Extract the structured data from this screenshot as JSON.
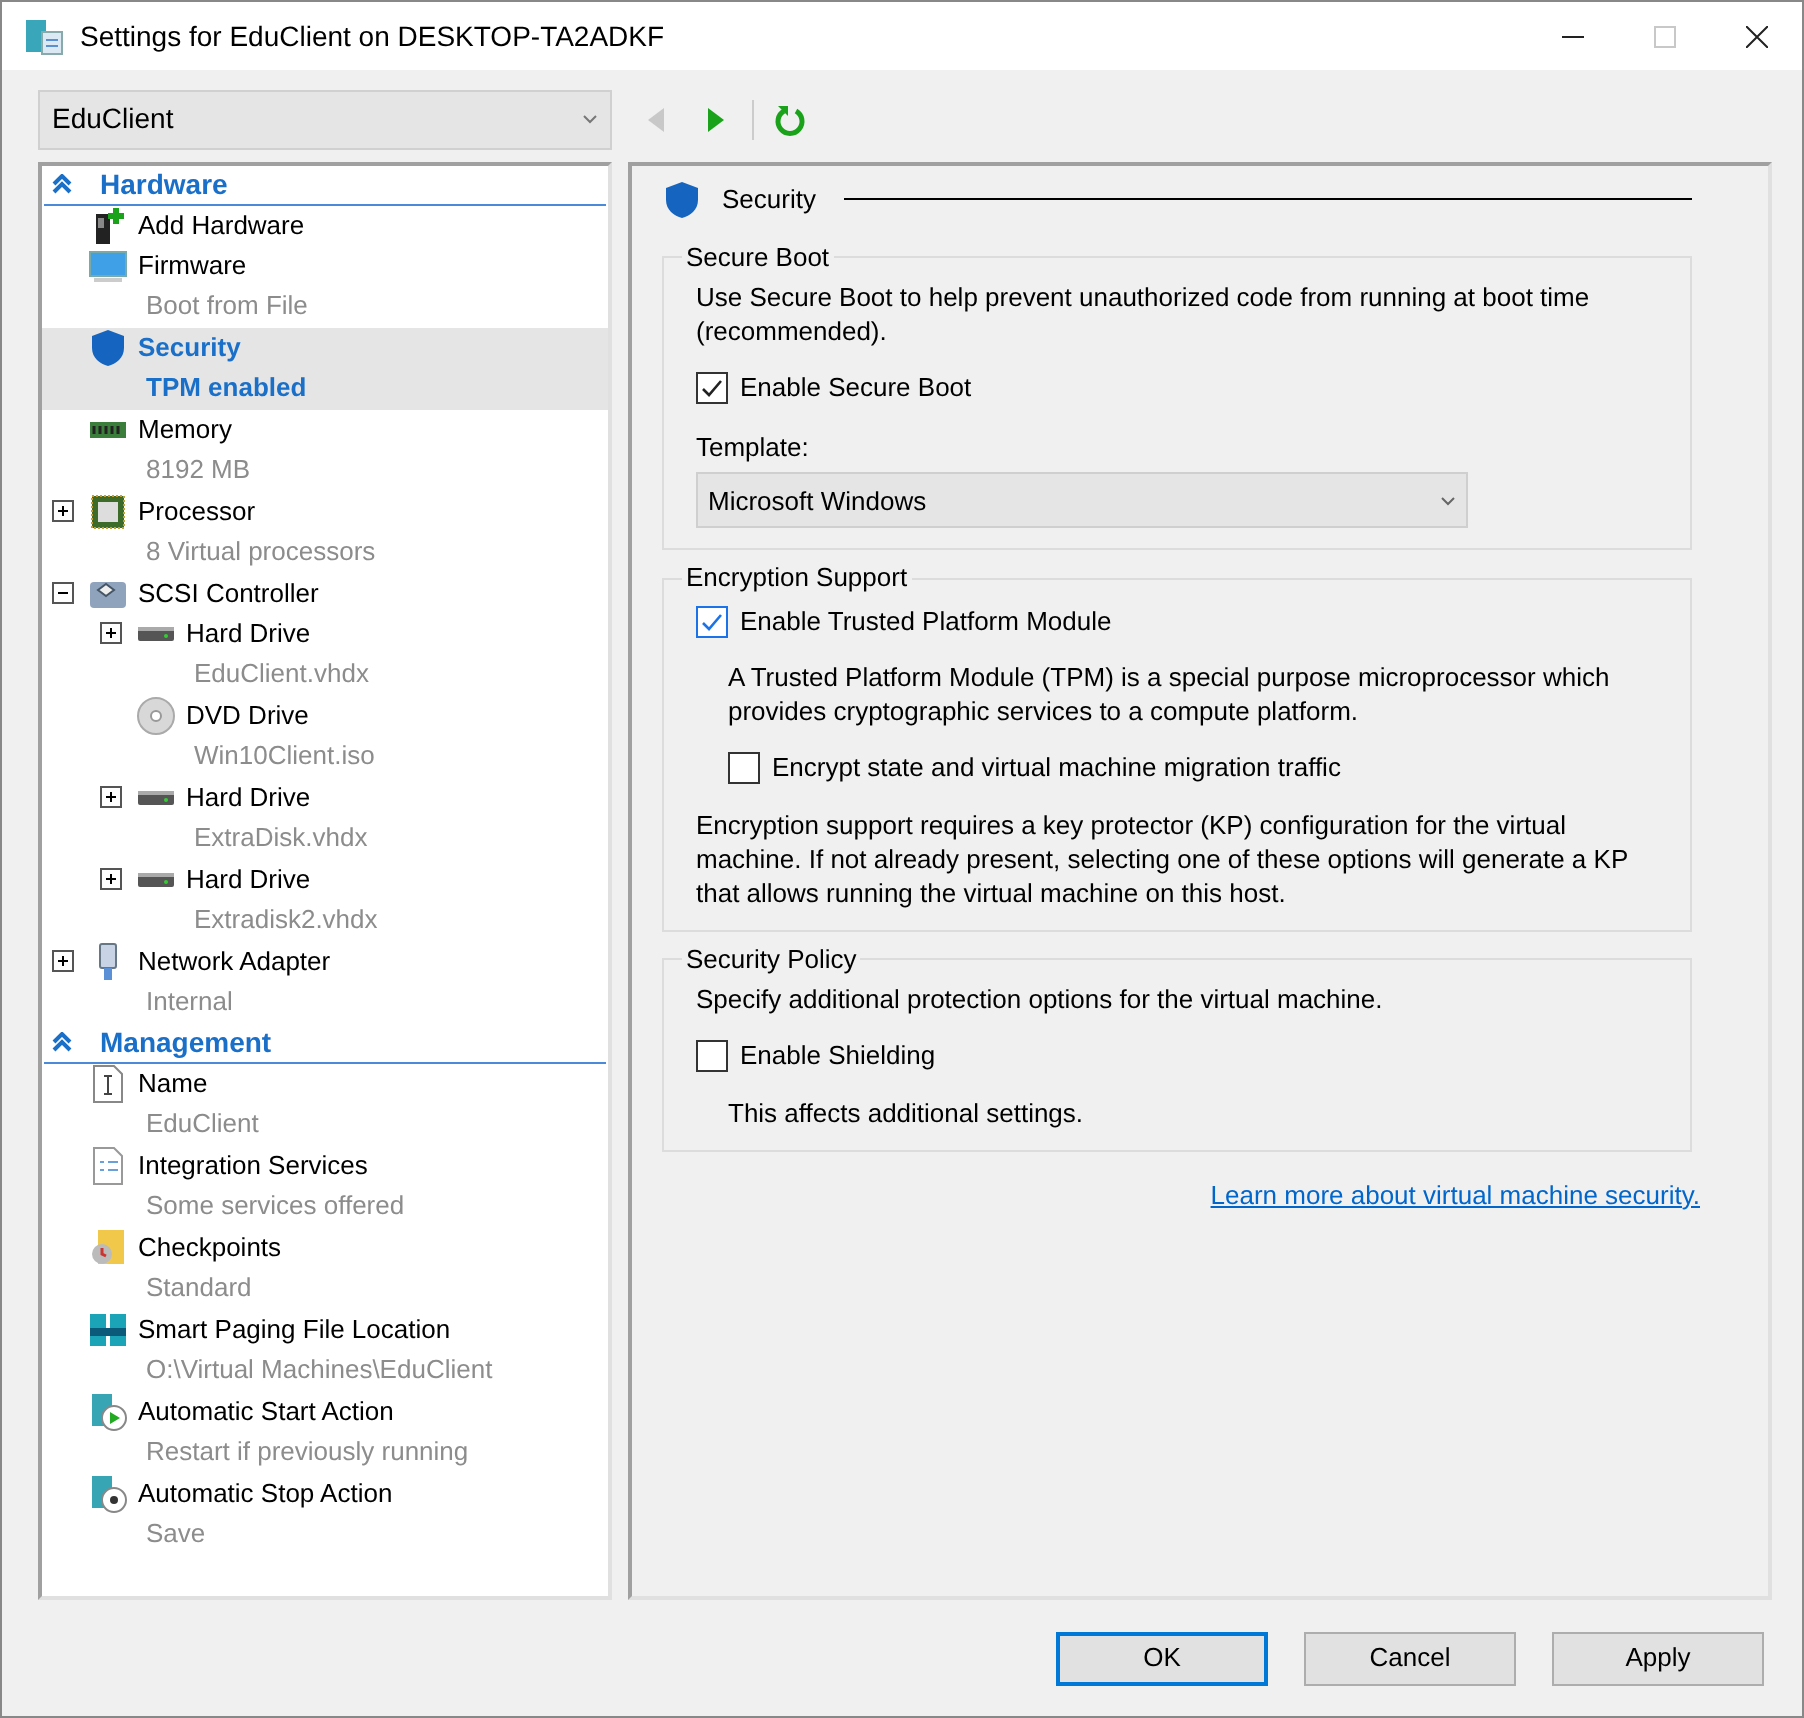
{
  "window": {
    "title": "Settings for EduClient on DESKTOP-TA2ADKF",
    "controls": [
      {
        "kind": "minimize",
        "disabled": false
      },
      {
        "kind": "maximize",
        "disabled": true
      },
      {
        "kind": "close",
        "disabled": false
      }
    ]
  },
  "vm_select": {
    "value": "EduClient"
  },
  "toolbar": [
    {
      "kind": "back",
      "disabled": true
    },
    {
      "kind": "forward",
      "disabled": false
    },
    {
      "kind": "refresh",
      "disabled": false
    }
  ],
  "tree": [
    {
      "title": "Hardware",
      "expanded": true,
      "items": [
        {
          "kind": "add-hardware",
          "label": "Add Hardware",
          "selected": false
        },
        {
          "kind": "firmware",
          "label": "Firmware",
          "detail": "Boot from File",
          "selected": false
        },
        {
          "kind": "security",
          "label": "Security",
          "detail": "TPM enabled",
          "selected": true
        },
        {
          "kind": "memory",
          "label": "Memory",
          "detail": "8192 MB",
          "selected": false
        },
        {
          "kind": "processor",
          "label": "Processor",
          "detail": "8 Virtual processors",
          "selected": false,
          "expanded": false
        },
        {
          "kind": "controller",
          "label": "SCSI Controller",
          "selected": false,
          "expanded": true,
          "children": [
            {
              "kind": "disk",
              "label": "Hard Drive",
              "detail": "EduClient.vhdx",
              "selected": false,
              "expanded": false
            },
            {
              "kind": "dvd",
              "label": "DVD Drive",
              "detail": "Win10Client.iso",
              "selected": false
            },
            {
              "kind": "disk",
              "label": "Hard Drive",
              "detail": "ExtraDisk.vhdx",
              "selected": false,
              "expanded": false
            },
            {
              "kind": "disk",
              "label": "Hard Drive",
              "detail": "Extradisk2.vhdx",
              "selected": false,
              "expanded": false
            }
          ]
        },
        {
          "kind": "network",
          "label": "Network Adapter",
          "detail": "Internal",
          "selected": false,
          "expanded": false
        }
      ]
    },
    {
      "title": "Management",
      "expanded": true,
      "items": [
        {
          "kind": "name",
          "label": "Name",
          "detail": "EduClient",
          "selected": false
        },
        {
          "kind": "integration",
          "label": "Integration Services",
          "detail": "Some services offered",
          "selected": false
        },
        {
          "kind": "checkpoints",
          "label": "Checkpoints",
          "detail": "Standard",
          "selected": false
        },
        {
          "kind": "paging",
          "label": "Smart Paging File Location",
          "detail": "O:\\Virtual Machines\\EduClient",
          "selected": false
        },
        {
          "kind": "start",
          "label": "Automatic Start Action",
          "detail": "Restart if previously running",
          "selected": false
        },
        {
          "kind": "stop",
          "label": "Automatic Stop Action",
          "detail": "Save",
          "selected": false
        }
      ]
    }
  ],
  "panel": {
    "title": "Security",
    "groups": [
      {
        "legend": "Secure Boot",
        "content": [
          {
            "kind": "text",
            "text": "Use Secure Boot to help prevent unauthorized code from running at boot time (recommended)."
          },
          {
            "kind": "checkbox",
            "label": "Enable Secure Boot",
            "checked": true,
            "focused": false
          },
          {
            "kind": "select",
            "label": "Template:",
            "value": "Microsoft Windows"
          }
        ]
      },
      {
        "legend": "Encryption Support",
        "content": [
          {
            "kind": "checkbox",
            "label": "Enable Trusted Platform Module",
            "checked": true,
            "focused": true
          },
          {
            "kind": "note",
            "text": "A Trusted Platform Module (TPM) is a special purpose microprocessor which provides cryptographic services to a compute platform."
          },
          {
            "kind": "sub_checkbox",
            "label": "Encrypt state and virtual machine migration traffic",
            "checked": false,
            "focused": false
          },
          {
            "kind": "text",
            "text": "Encryption support requires a key protector (KP) configuration for the virtual machine. If not already present, selecting one of these options will generate a KP that allows running the virtual machine on this host."
          }
        ]
      },
      {
        "legend": "Security Policy",
        "content": [
          {
            "kind": "text",
            "text": "Specify additional protection options for the virtual machine."
          },
          {
            "kind": "checkbox",
            "label": "Enable Shielding",
            "checked": false,
            "focused": false
          },
          {
            "kind": "note",
            "text": "This affects additional settings."
          }
        ]
      }
    ],
    "link": "Learn more about virtual machine security."
  },
  "buttons": [
    {
      "label": "OK",
      "default": true
    },
    {
      "label": "Cancel",
      "default": false
    },
    {
      "label": "Apply",
      "default": false
    }
  ]
}
